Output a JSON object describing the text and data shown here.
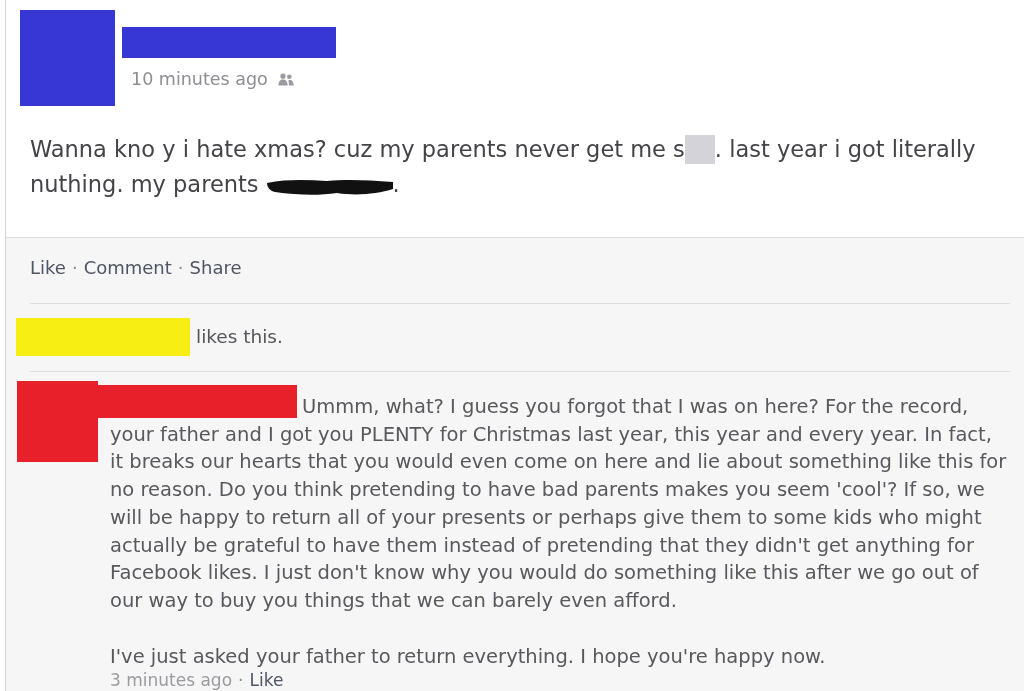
{
  "post": {
    "time": "10 minutes ago",
    "lines": [
      {
        "segments": [
          {
            "kind": "text",
            "text": "Wanna kno y i hate xmas? cuz my parents never get me s"
          },
          {
            "kind": "blur"
          },
          {
            "kind": "text",
            "text": ". last year i got literally"
          }
        ]
      },
      {
        "segments": [
          {
            "kind": "text",
            "text": "nuthing. my parents"
          },
          {
            "kind": "scribble"
          },
          {
            "kind": "text",
            "text": "."
          }
        ]
      }
    ]
  },
  "actions": [
    {
      "kind": "link",
      "text": "Like"
    },
    {
      "kind": "separator",
      "text": "·"
    },
    {
      "kind": "link",
      "text": "Comment"
    },
    {
      "kind": "separator",
      "text": "·"
    },
    {
      "kind": "link",
      "text": "Share"
    }
  ],
  "likes": {
    "text": "likes this."
  },
  "comment": {
    "lead": "Ummm, what? I guess you forgot that I was on here? For the record,",
    "paragraphs": [
      "your father and I got you PLENTY for Christmas last year, this year and every year. In fact, it breaks our hearts that you would even come on here and lie about something like this for no reason. Do you think pretending to have bad parents makes you seem 'cool'? If so, we will be happy to return all of your presents or perhaps give them to some kids who might actually be grateful to have them instead of pretending that they didn't get anything for Facebook likes. I just don't know why you would do something like this after we go out of our way to buy you things that we can barely even afford.",
      "I've just asked your father to return everything. I hope you're happy now."
    ],
    "meta": [
      {
        "kind": "time",
        "text": "3 minutes ago"
      },
      {
        "kind": "separator",
        "text": "·"
      },
      {
        "kind": "link",
        "text": "Like"
      }
    ]
  }
}
